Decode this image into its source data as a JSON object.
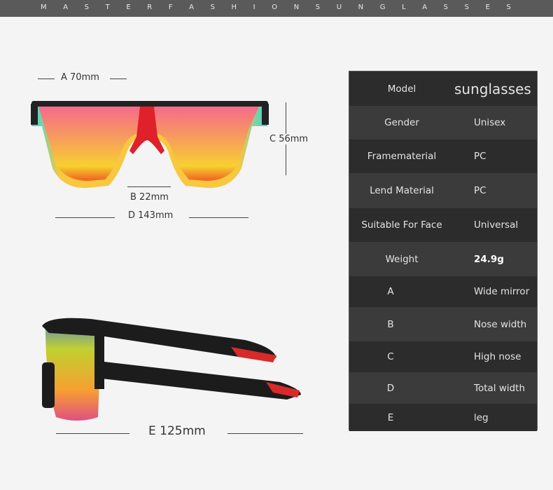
{
  "banner": {
    "letters": [
      "M",
      "A",
      "S",
      "T",
      "E",
      "R",
      "F",
      "A",
      "S",
      "H",
      "I",
      "O",
      "N",
      "S",
      "U",
      "N",
      "G",
      "L",
      "A",
      "S",
      "S",
      "E",
      "S"
    ]
  },
  "dimensions": {
    "a": "A 70mm",
    "b": "B 22mm",
    "c": "C 56mm",
    "d": "D 143mm",
    "e": "E 125mm"
  },
  "specs": [
    {
      "key": "Model",
      "value": "sunglasses"
    },
    {
      "key": "Gender",
      "value": "Unisex"
    },
    {
      "key": "Framematerial",
      "value": "PC"
    },
    {
      "key": "Lend Material",
      "value": "PC"
    },
    {
      "key": "Suitable For Face",
      "value": "Universal"
    },
    {
      "key": "Weight",
      "value": "24.9g"
    },
    {
      "key": "A",
      "value": "Wide mirror"
    },
    {
      "key": "B",
      "value": "Nose width"
    },
    {
      "key": "C",
      "value": "High nose"
    },
    {
      "key": "D",
      "value": "Total width"
    },
    {
      "key": "E",
      "value": "leg"
    }
  ],
  "colors": {
    "dark_row": "#2c2c2c",
    "light_row": "#3b3b3b",
    "banner": "#5a5a5a"
  }
}
